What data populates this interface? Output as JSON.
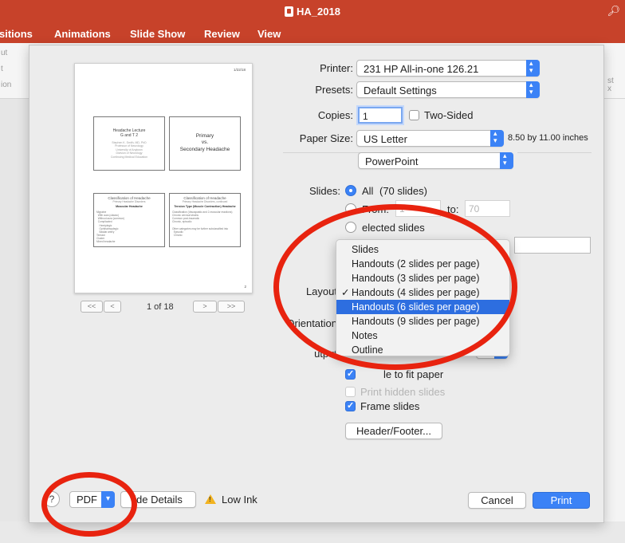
{
  "app": {
    "document_title": "HA_2018",
    "ribbon_tabs": [
      "sitions",
      "Animations",
      "Slide Show",
      "Review",
      "View"
    ],
    "ribbon_ghost": [
      "ut",
      "t",
      "ion",
      "st",
      "x"
    ]
  },
  "preview": {
    "date": "1/22/18",
    "page_number": "2",
    "slide1": {
      "title": "Headache Lecture\nG and T 2",
      "subtitle": "Stephen K. Smith, MD, PhD\nProfessor of Neurology\nUniversity of Anytown\nDivision of Neurology\nContinuing Medical Education"
    },
    "slide2": {
      "title": "Primary\nvs.\nSecondary Headache"
    },
    "slide3": {
      "title": "Classification of Headache",
      "subtitle": "Primary Headache Disorders",
      "heading": "Muscular Headache",
      "body": "Migraine\n  With aura (classic)\n  Without aura (common)\n  Complicated\n    Hemiplegic\n    Ophthalmoplegic\n    Basilar artery\nTension\nCluster\nMixed headache"
    },
    "slide4": {
      "title": "Classification of Headache",
      "subtitle": "Primary Headache Disorders, continued",
      "heading": "Tension Type (Muscle Contraction) Headache",
      "body": "Classification (Vasospastic and 2-muscular reactions)\nChronic cervical strains\nCommon post-traumatic\nChronic, episodic\n\nOther categories may be further subclassified into\n  Episodic\n  Chronic"
    },
    "pager": {
      "first": "<<",
      "prev": "<",
      "next": ">",
      "last": ">>",
      "indicator": "1 of 18"
    }
  },
  "form": {
    "printer_label": "Printer:",
    "printer_value": "231 HP All-in-one 126.21",
    "presets_label": "Presets:",
    "presets_value": "Default Settings",
    "copies_label": "Copies:",
    "copies_value": "1",
    "two_sided_label": "Two-Sided",
    "paper_size_label": "Paper Size:",
    "paper_size_value": "US Letter",
    "paper_size_dims": "8.50 by 11.00 inches",
    "section_value": "PowerPoint",
    "slides_label": "Slides:",
    "all_label": "All",
    "all_count": "(70 slides)",
    "from_label": "From:",
    "from_value": "1",
    "to_label": "to:",
    "to_value": "70",
    "selected_label": "elected slides",
    "layout_label": "Layout",
    "orientation_label": "Orientation",
    "output_label": "utput",
    "scale_label": "le to fit paper",
    "print_hidden_label": "Print hidden slides",
    "frame_slides_label": "Frame slides",
    "header_footer_button": "Header/Footer..."
  },
  "layout_menu": {
    "items": [
      "Slides",
      "Handouts (2 slides per page)",
      "Handouts (3 slides per page)",
      "Handouts (4 slides per page)",
      "Handouts (6 slides per page)",
      "Handouts (9 slides per page)",
      "Notes",
      "Outline"
    ],
    "checked_mark": "✓",
    "checked_index": 3,
    "highlighted_index": 4
  },
  "footer": {
    "help": "?",
    "pdf_label": "PDF",
    "details_label": "ide Details",
    "low_ink_label": "Low Ink",
    "cancel_label": "Cancel",
    "print_label": "Print"
  },
  "colors": {
    "app_accent": "#c7422a",
    "mac_blue": "#3b82f6",
    "menu_highlight": "#2d6ee0",
    "annotation_red": "#e8230f",
    "warning_yellow": "#f2b31f"
  }
}
